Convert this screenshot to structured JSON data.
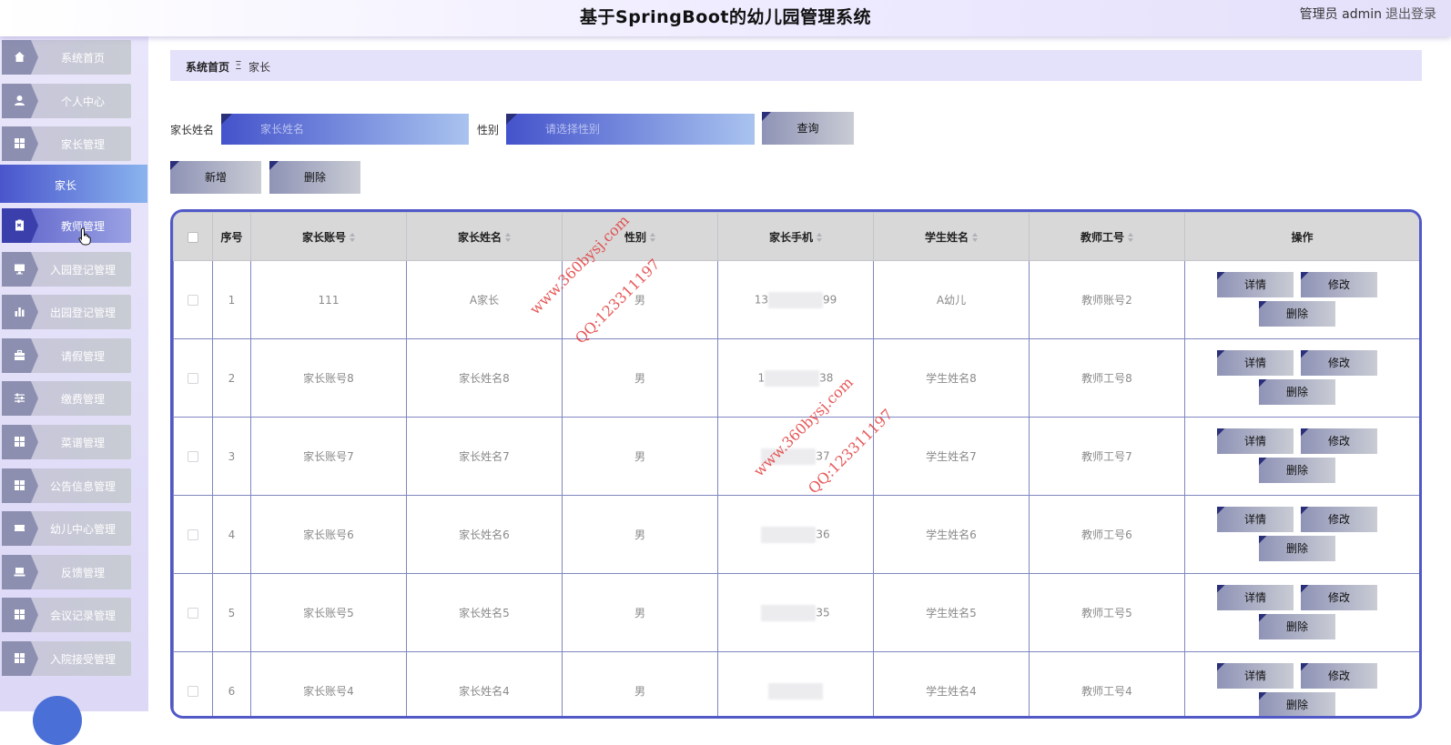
{
  "header": {
    "title": "基于SpringBoot的幼儿园管理系统",
    "user": "管理员 admin",
    "logout": "退出登录"
  },
  "sidebar": {
    "items": [
      {
        "label": "系统首页",
        "icon": "home-icon"
      },
      {
        "label": "个人中心",
        "icon": "user-icon"
      },
      {
        "label": "家长管理",
        "icon": "grid-icon"
      },
      {
        "label": "教师管理",
        "icon": "clipboard-icon"
      },
      {
        "label": "入园登记管理",
        "icon": "monitor-icon"
      },
      {
        "label": "出园登记管理",
        "icon": "bar-chart-icon"
      },
      {
        "label": "请假管理",
        "icon": "briefcase-icon"
      },
      {
        "label": "缴费管理",
        "icon": "sliders-icon"
      },
      {
        "label": "菜谱管理",
        "icon": "grid-icon"
      },
      {
        "label": "公告信息管理",
        "icon": "grid-icon"
      },
      {
        "label": "幼儿中心管理",
        "icon": "ticket-icon"
      },
      {
        "label": "反馈管理",
        "icon": "laptop-icon"
      },
      {
        "label": "会议记录管理",
        "icon": "grid-icon"
      },
      {
        "label": "入院接受管理",
        "icon": "grid-icon"
      }
    ],
    "submenu_label": "家长"
  },
  "breadcrumb": {
    "home": "系统首页",
    "separator": "Ξ",
    "current": "家长"
  },
  "search": {
    "name_label": "家长姓名",
    "name_placeholder": "家长姓名",
    "gender_label": "性别",
    "gender_placeholder": "请选择性别",
    "query_button": "查询"
  },
  "actions": {
    "add_button": "新增",
    "delete_button": "删除"
  },
  "table": {
    "headers": {
      "index": "序号",
      "account": "家长账号",
      "name": "家长姓名",
      "gender": "性别",
      "phone": "家长手机",
      "student": "学生姓名",
      "teacher": "教师工号",
      "ops": "操作"
    },
    "op_labels": {
      "detail": "详情",
      "edit": "修改",
      "delete": "删除"
    },
    "rows": [
      {
        "index": "1",
        "account": "111",
        "name": "A家长",
        "gender": "男",
        "phone_head": "13",
        "phone_tail": "99",
        "student": "A幼儿",
        "teacher": "教师账号2"
      },
      {
        "index": "2",
        "account": "家长账号8",
        "name": "家长姓名8",
        "gender": "男",
        "phone_head": "1",
        "phone_tail": "38",
        "student": "学生姓名8",
        "teacher": "教师工号8"
      },
      {
        "index": "3",
        "account": "家长账号7",
        "name": "家长姓名7",
        "gender": "男",
        "phone_head": "",
        "phone_tail": "37",
        "student": "学生姓名7",
        "teacher": "教师工号7"
      },
      {
        "index": "4",
        "account": "家长账号6",
        "name": "家长姓名6",
        "gender": "男",
        "phone_head": "",
        "phone_tail": "36",
        "student": "学生姓名6",
        "teacher": "教师工号6"
      },
      {
        "index": "5",
        "account": "家长账号5",
        "name": "家长姓名5",
        "gender": "男",
        "phone_head": "",
        "phone_tail": "35",
        "student": "学生姓名5",
        "teacher": "教师工号5"
      },
      {
        "index": "6",
        "account": "家长账号4",
        "name": "家长姓名4",
        "gender": "男",
        "phone_head": "",
        "phone_tail": "",
        "student": "学生姓名4",
        "teacher": "教师工号4"
      }
    ]
  },
  "watermarks": {
    "site": "www.360bysj.com",
    "qq": "QQ:123311197"
  },
  "colors": {
    "accent": "#5159c7",
    "sidebar_bg": "#e4e1fb",
    "button_gray": "#8f93b6",
    "watermark_red": "#e23a3a"
  }
}
